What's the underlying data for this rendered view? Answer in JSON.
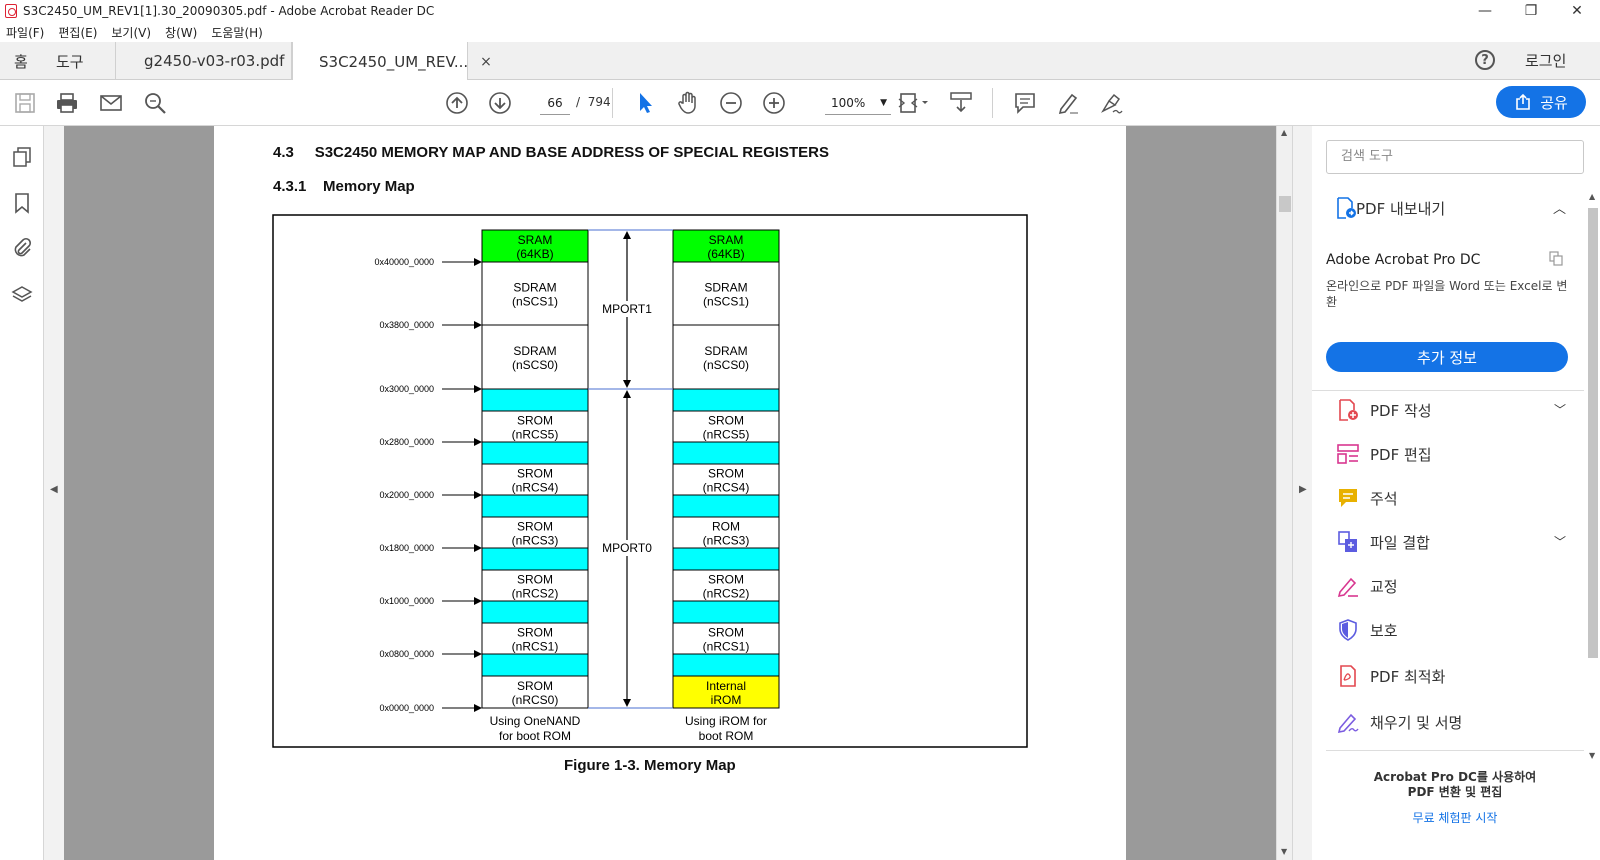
{
  "window": {
    "title": "S3C2450_UM_REV1[1].30_20090305.pdf - Adobe Acrobat Reader DC"
  },
  "menu": [
    "파일(F)",
    "편집(E)",
    "보기(V)",
    "창(W)",
    "도움말(H)"
  ],
  "tabs": {
    "home": "홈",
    "tools": "도구",
    "doc1": "g2450-v03-r03.pdf",
    "doc2": "S3C2450_UM_REV...",
    "close": "×"
  },
  "account": {
    "login": "로그인",
    "help": "?"
  },
  "toolbar": {
    "page_current": "66",
    "page_sep": "/",
    "page_total": "794",
    "zoom": "100%",
    "share_label": "공유"
  },
  "right_panel": {
    "search_placeholder": "검색 도구",
    "export_label": "PDF 내보내기",
    "upsell_title": "Adobe Acrobat Pro DC",
    "upsell_desc": "온라인으로 PDF 파일을 Word 또는 Excel로 변환",
    "more_info": "추가 정보",
    "tools": [
      "PDF 작성",
      "PDF 편집",
      "주석",
      "파일 결합",
      "교정",
      "보호",
      "PDF 최적화",
      "채우기 및 서명"
    ],
    "promo_line1": "Acrobat Pro DC를 사용하여",
    "promo_line2": "PDF 변환 및 편집",
    "trial": "무료 체험판 시작"
  },
  "document": {
    "section_title": "4.3     S3C2450 MEMORY MAP AND BASE ADDRESS OF SPECIAL REGISTERS",
    "subsection_title": "4.3.1    Memory Map",
    "figure_caption": "Figure 1-3. Memory Map",
    "addresses": [
      "0x40000_0000",
      "0x3800_0000",
      "0x3000_0000",
      "0x2800_0000",
      "0x2000_0000",
      "0x1800_0000",
      "0x1000_0000",
      "0x0800_0000",
      "0x0000_0000"
    ],
    "left_column": {
      "caption_line1": "Using OneNAND",
      "caption_line2": "for boot ROM",
      "blocks": [
        [
          "SRAM",
          "(64KB)"
        ],
        [
          "SDRAM",
          "(nSCS1)"
        ],
        [
          "SDRAM",
          "(nSCS0)"
        ],
        [
          "SROM",
          "(nRCS5)"
        ],
        [
          "SROM",
          "(nRCS4)"
        ],
        [
          "SROM",
          "(nRCS3)"
        ],
        [
          "SROM",
          "(nRCS2)"
        ],
        [
          "SROM",
          "(nRCS1)"
        ],
        [
          "SROM",
          "(nRCS0)"
        ]
      ]
    },
    "right_column": {
      "caption_line1": "Using iROM for",
      "caption_line2": "boot ROM",
      "blocks": [
        [
          "SRAM",
          "(64KB)"
        ],
        [
          "SDRAM",
          "(nSCS1)"
        ],
        [
          "SDRAM",
          "(nSCS0)"
        ],
        [
          "SROM",
          "(nRCS5)"
        ],
        [
          "SROM",
          "(nRCS4)"
        ],
        [
          "ROM",
          "(nRCS3)"
        ],
        [
          "SROM",
          "(nRCS2)"
        ],
        [
          "SROM",
          "(nRCS1)"
        ],
        [
          "Internal",
          "iROM"
        ]
      ]
    },
    "mport1": "MPORT1",
    "mport0": "MPORT0",
    "colors": {
      "sram": "#00ff00",
      "gap": "#00ffff",
      "irom": "#ffff00"
    }
  }
}
